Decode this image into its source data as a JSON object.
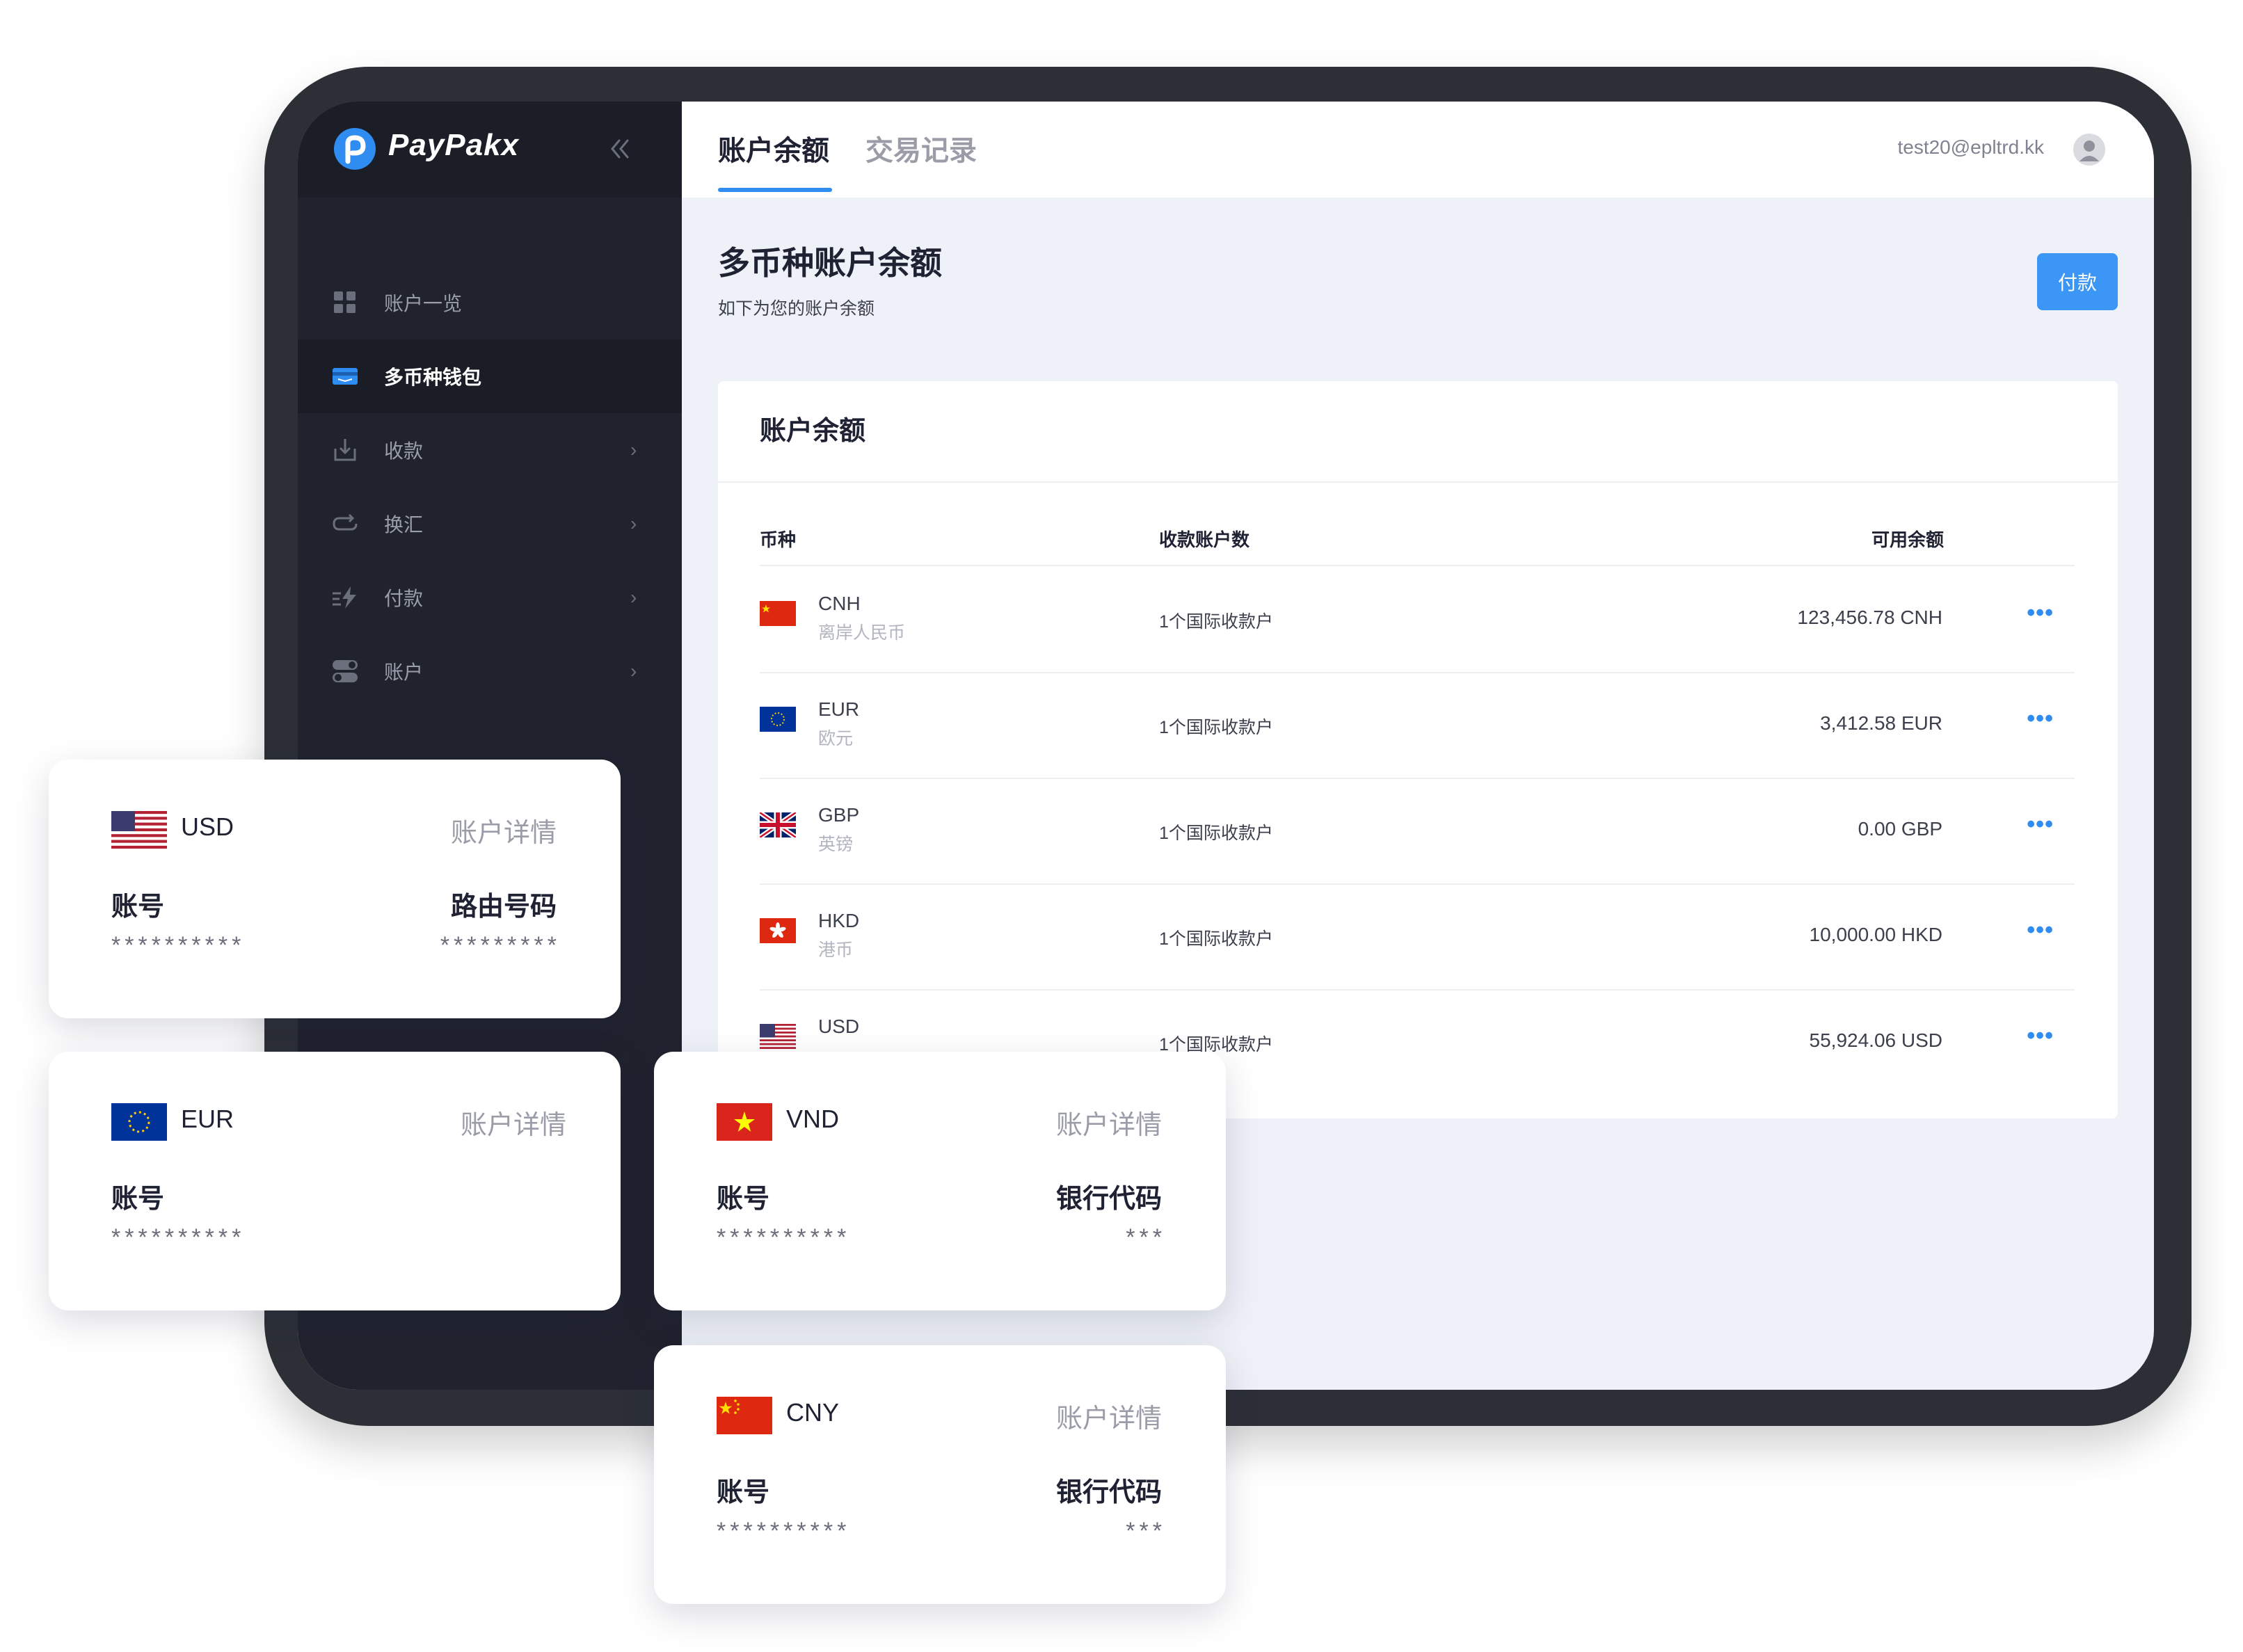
{
  "app": {
    "brand": "PayPakx",
    "colors": {
      "accent": "#2f8df2",
      "sidebar": "#20222e",
      "background": "#eef1f7"
    }
  },
  "sidebar": {
    "collapse_icon": "double-chevron-left-icon",
    "items": [
      {
        "label": "账户一览",
        "icon": "grid-icon",
        "has_submenu": false,
        "active": false
      },
      {
        "label": "多币种钱包",
        "icon": "wallet-card-icon",
        "has_submenu": false,
        "active": true
      },
      {
        "label": "收款",
        "icon": "receive-download-icon",
        "has_submenu": true,
        "active": false
      },
      {
        "label": "换汇",
        "icon": "exchange-arrows-icon",
        "has_submenu": true,
        "active": false
      },
      {
        "label": "付款",
        "icon": "lightning-send-icon",
        "has_submenu": true,
        "active": false
      },
      {
        "label": "账户",
        "icon": "toggle-account-icon",
        "has_submenu": true,
        "active": false
      }
    ],
    "chevron": "›"
  },
  "header": {
    "tabs": [
      {
        "label": "账户余额",
        "active": true
      },
      {
        "label": "交易记录",
        "active": false
      }
    ],
    "user_email": "test20@epltrd.kk"
  },
  "page": {
    "title": "多币种账户余额",
    "subtitle": "如下为您的账户余额",
    "pay_button": "付款"
  },
  "balance_card": {
    "title": "账户余额",
    "columns": {
      "currency": "币种",
      "accounts": "收款账户数",
      "available": "可用余额"
    },
    "rows": [
      {
        "code": "CNH",
        "name": "离岸人民币",
        "accounts": "1个国际收款户",
        "balance": "123,456.78 CNH",
        "flag": "cn"
      },
      {
        "code": "EUR",
        "name": "欧元",
        "accounts": "1个国际收款户",
        "balance": "3,412.58 EUR",
        "flag": "eu"
      },
      {
        "code": "GBP",
        "name": "英镑",
        "accounts": "1个国际收款户",
        "balance": "0.00 GBP",
        "flag": "gb"
      },
      {
        "code": "HKD",
        "name": "港币",
        "accounts": "1个国际收款户",
        "balance": "10,000.00 HKD",
        "flag": "hk"
      },
      {
        "code": "USD",
        "name": "",
        "accounts": "1个国际收款户",
        "balance": "55,924.06 USD",
        "flag": "us"
      }
    ],
    "more_label": "•••"
  },
  "account_cards": [
    {
      "code": "USD",
      "detail": "账户详情",
      "label_left": "账号",
      "label_right": "路由号码",
      "stars_left": "**********",
      "stars_right": "*********",
      "flag": "us"
    },
    {
      "code": "EUR",
      "detail": "账户详情",
      "label_left": "账号",
      "label_right": "",
      "stars_left": "**********",
      "stars_right": "",
      "flag": "eu"
    },
    {
      "code": "VND",
      "detail": "账户详情",
      "label_left": "账号",
      "label_right": "银行代码",
      "stars_left": "**********",
      "stars_right": "***",
      "flag": "vn"
    },
    {
      "code": "CNY",
      "detail": "账户详情",
      "label_left": "账号",
      "label_right": "银行代码",
      "stars_left": "**********",
      "stars_right": "***",
      "flag": "cn"
    }
  ]
}
